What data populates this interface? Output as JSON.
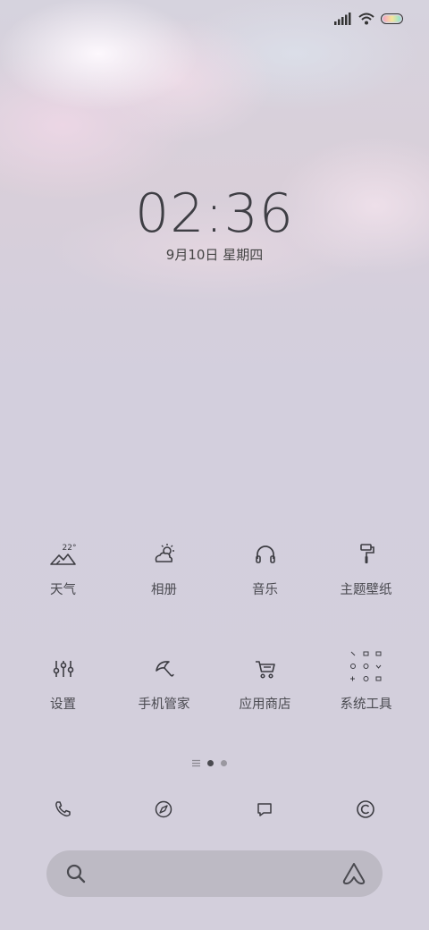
{
  "time": "02:36",
  "date": "9月10日 星期四",
  "apps": [
    {
      "label": "天气",
      "icon": "weather-icon",
      "temp": "22°"
    },
    {
      "label": "相册",
      "icon": "gallery-icon"
    },
    {
      "label": "音乐",
      "icon": "headphones-icon"
    },
    {
      "label": "主题壁纸",
      "icon": "paint-roller-icon"
    },
    {
      "label": "设置",
      "icon": "sliders-icon"
    },
    {
      "label": "手机管家",
      "icon": "umbrella-icon"
    },
    {
      "label": "应用商店",
      "icon": "cart-icon"
    },
    {
      "label": "系统工具",
      "icon": "folder-grid-icon"
    }
  ],
  "dock": [
    "phone-icon",
    "compass-icon",
    "message-icon",
    "copyright-icon"
  ],
  "page_indicator": {
    "total_pages": 2,
    "current": 1
  },
  "colors": {
    "icon": "#3c3c42",
    "text": "#4a4a50",
    "search_bg": "#bdbac4"
  }
}
